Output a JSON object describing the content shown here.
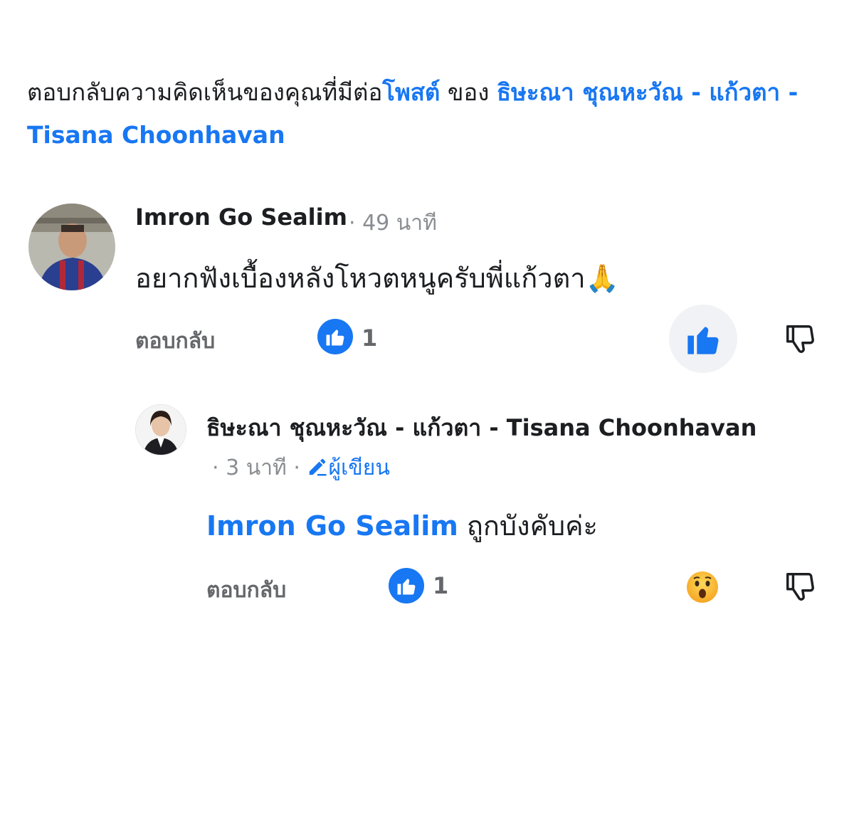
{
  "header": {
    "prefix": "ตอบกลับความคิดเห็นของคุณที่มีต่อ",
    "post_link": "โพสต์",
    "middle": " ของ ",
    "page_name": "ธิษะณา ชุณหะวัณ - แก้วตา - Tisana Choonhavan"
  },
  "comments": [
    {
      "author": "Imron Go Sealim",
      "time": "· 49 นาที",
      "text": "อยากฟังเบื้องหลังโหวตหนูครับพี่แก้วตา",
      "emoji": "🙏",
      "reply_label": "ตอบกลับ",
      "like_count": "1",
      "reaction": "like",
      "reaction_color": "#1877f2"
    }
  ],
  "reply": {
    "author": "ธิษะณา ชุณหะวัณ - แก้วตา - Tisana Choonhavan",
    "time": "· 3 นาที ·",
    "author_badge": "ผู้เขียน",
    "mention": "Imron Go Sealim",
    "text": " ถูกบังคับค่ะ",
    "reply_label": "ตอบกลับ",
    "like_count": "1",
    "reaction": "wow"
  },
  "colors": {
    "accent": "#1877f2",
    "secondary_text": "#65676b",
    "meta_text": "#8a8d91"
  }
}
